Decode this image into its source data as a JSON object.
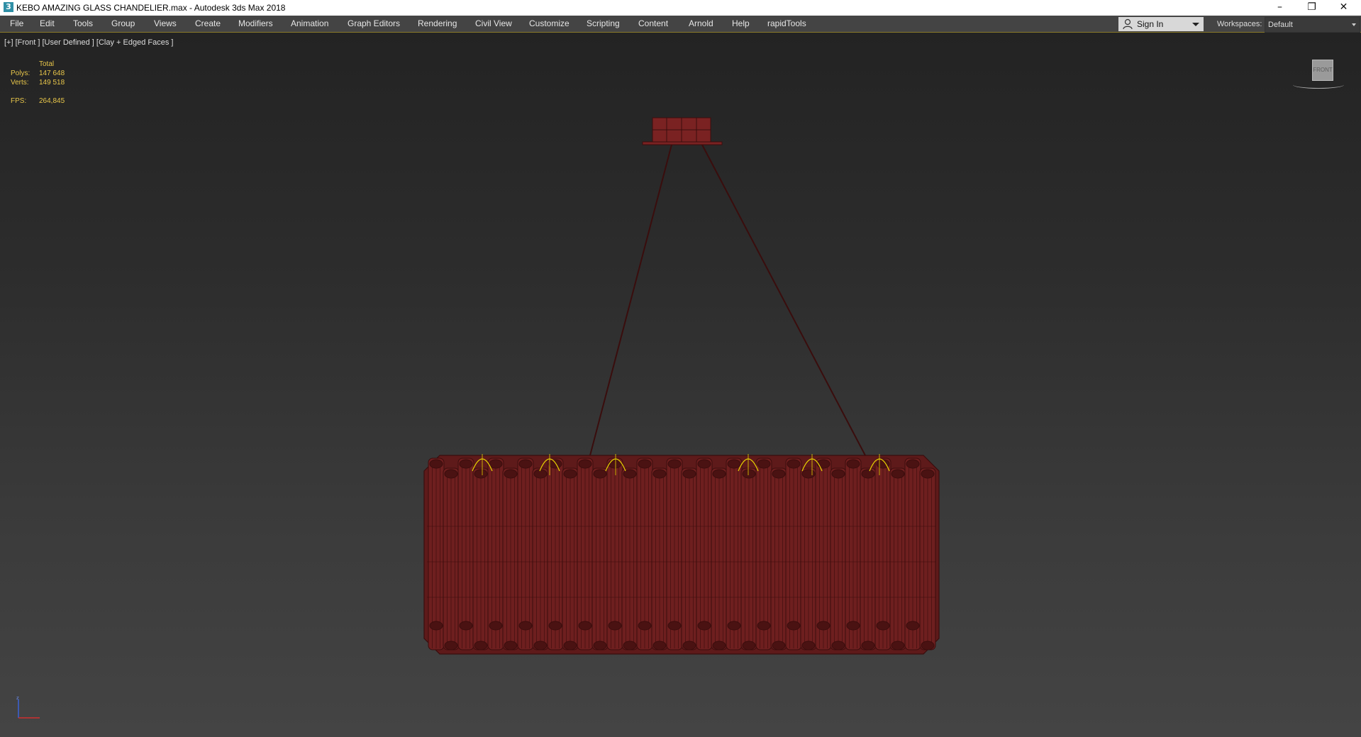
{
  "window": {
    "app_icon_glyph": "3",
    "title": "KEBO AMAZING GLASS CHANDELIER.max - Autodesk 3ds Max 2018",
    "minimize_glyph": "–",
    "restore_glyph": "❐",
    "close_glyph": "✕"
  },
  "menu": {
    "items": [
      "File",
      "Edit",
      "Tools",
      "Group",
      "Views",
      "Create",
      "Modifiers",
      "Animation",
      "Graph Editors",
      "Rendering",
      "Civil View",
      "Customize",
      "Scripting",
      "Content",
      "Arnold",
      "Help",
      "rapidTools"
    ]
  },
  "account": {
    "sign_in_label": "Sign In",
    "workspaces_label": "Workspaces:",
    "workspace_value": "Default"
  },
  "viewport": {
    "label": "[+] [Front ] [User Defined ] [Clay + Edged Faces ]",
    "stats": {
      "total_label": "Total",
      "polys_label": "Polys:",
      "polys_value": "147 648",
      "verts_label": "Verts:",
      "verts_value": "149 518",
      "fps_label": "FPS:",
      "fps_value": "264,845"
    },
    "viewcube_label": "FRONT"
  },
  "colors": {
    "model_fill": "#6e1f1f",
    "model_edge": "#3a0d0d",
    "highlight": "#e8d400",
    "stats_text": "#e8c64a"
  }
}
